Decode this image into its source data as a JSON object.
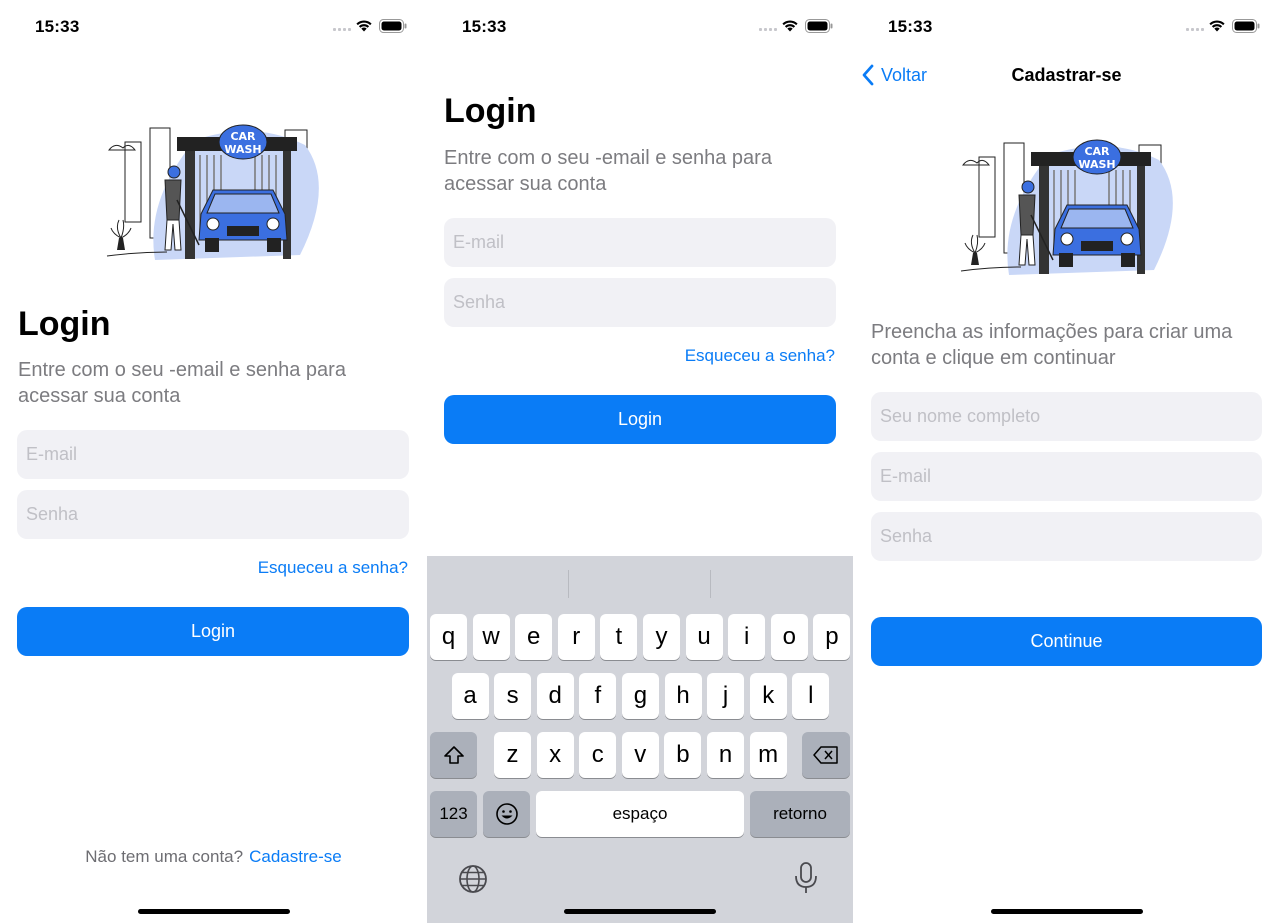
{
  "status": {
    "time": "15:33"
  },
  "illustration": {
    "sign_line1": "CAR",
    "sign_line2": "WASH"
  },
  "login": {
    "title": "Login",
    "subtitle": "Entre com o seu -email e senha para acessar sua conta",
    "email_placeholder": "E-mail",
    "password_placeholder": "Senha",
    "forgot_label": "Esqueceu a senha?",
    "login_button": "Login",
    "no_account_text": "Não tem uma conta?",
    "signup_link": "Cadastre-se"
  },
  "keyboard": {
    "row1": [
      "q",
      "w",
      "e",
      "r",
      "t",
      "y",
      "u",
      "i",
      "o",
      "p"
    ],
    "row2": [
      "a",
      "s",
      "d",
      "f",
      "g",
      "h",
      "j",
      "k",
      "l"
    ],
    "row3": [
      "z",
      "x",
      "c",
      "v",
      "b",
      "n",
      "m"
    ],
    "numbers_key": "123",
    "space_key": "espaço",
    "return_key": "retorno"
  },
  "signup": {
    "back_label": "Voltar",
    "nav_title": "Cadastrar-se",
    "subtitle": "Preencha as informações para criar uma conta e clique em continuar",
    "name_placeholder": "Seu nome completo",
    "email_placeholder": "E-mail",
    "password_placeholder": "Senha",
    "continue_button": "Continue"
  },
  "colors": {
    "accent": "#0a7cf6",
    "field_bg": "#f1f1f5",
    "keyboard_bg": "#d2d4da",
    "car_blue": "#3b6fe0"
  }
}
